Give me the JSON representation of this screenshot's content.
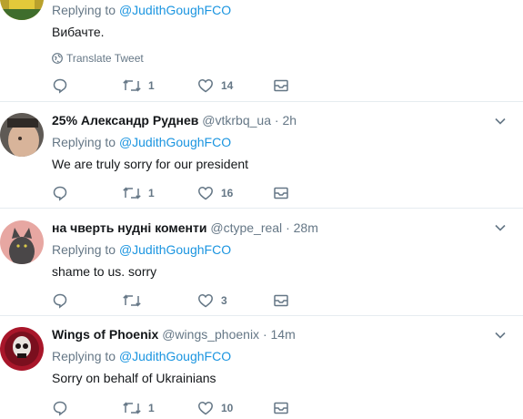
{
  "tweets": [
    {
      "fullname": "",
      "handle": "",
      "time": "",
      "replying_prefix": "Replying to",
      "replying_to": "@JudithGoughFCO",
      "text": "Вибачте.",
      "translate": "Translate Tweet",
      "retweets": "1",
      "likes": "14",
      "avatar_color": "#c9b233"
    },
    {
      "fullname": "25% Александр Руднев",
      "handle": "@vtkrbq_ua",
      "time": "2h",
      "replying_prefix": "Replying to",
      "replying_to": "@JudithGoughFCO",
      "text": "We are truly sorry for our president",
      "retweets": "1",
      "likes": "16",
      "avatar_color": "#8a7a6c"
    },
    {
      "fullname": "на чверть нудні коменти",
      "handle": "@ctype_real",
      "time": "28m",
      "replying_prefix": "Replying to",
      "replying_to": "@JudithGoughFCO",
      "text": "shame to us. sorry",
      "retweets": "",
      "likes": "3",
      "avatar_color": "#d98a86"
    },
    {
      "fullname": "Wings of Phoenix",
      "handle": "@wings_phoenix",
      "time": "14m",
      "replying_prefix": "Replying to",
      "replying_to": "@JudithGoughFCO",
      "text": "Sorry on behalf of Ukrainians",
      "retweets": "1",
      "likes": "10",
      "avatar_color": "#a8162a"
    }
  ],
  "colors": {
    "link": "#1b95e0",
    "muted": "#657786",
    "divider": "#e6ecf0"
  },
  "icons": {
    "reply": "reply-icon",
    "retweet": "retweet-icon",
    "like": "heart-icon",
    "dm": "envelope-icon",
    "more": "chevron-down-icon",
    "globe": "globe-icon"
  }
}
